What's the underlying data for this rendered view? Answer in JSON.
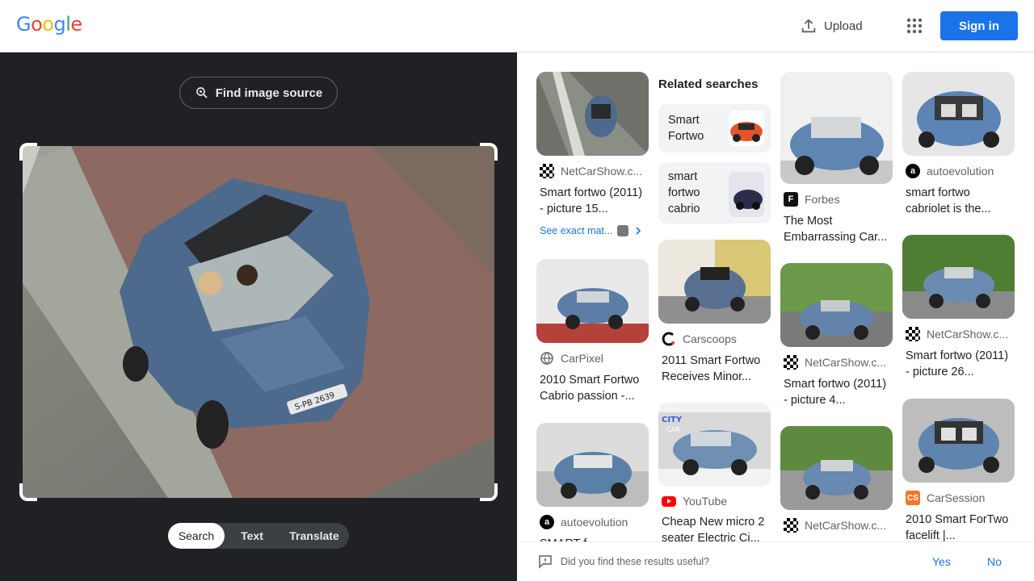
{
  "header": {
    "logo_letters": [
      "G",
      "o",
      "o",
      "g",
      "l",
      "e"
    ],
    "upload_label": "Upload",
    "signin_label": "Sign in",
    "colors": {
      "blue": "#4285f4",
      "red": "#ea4335",
      "yellow": "#fbbc05",
      "green": "#34a853",
      "accent": "#1a73e8"
    }
  },
  "lens": {
    "find_source_label": "Find image source",
    "modes": [
      "Search",
      "Text",
      "Translate"
    ],
    "active_mode": "Search",
    "plate_text": "S-PB 2639"
  },
  "results": {
    "related_heading": "Related searches",
    "related": [
      {
        "label": "Smart\nFortwo",
        "lines": [
          "Smart",
          "Fortwo"
        ]
      },
      {
        "label": "smart fortwo cabrio",
        "lines": [
          "smart",
          "fortwo",
          "cabrio"
        ]
      }
    ],
    "see_exact": "See exact mat...",
    "col1": [
      {
        "source": "NetCarShow.c...",
        "title": "Smart fortwo (2011) - picture 15...",
        "icon": "checker-icon"
      },
      {
        "source": "CarPixel",
        "title": "2010 Smart Fortwo Cabrio passion -...",
        "icon": "globe-icon"
      },
      {
        "source": "autoevolution",
        "title": "SMART f...",
        "icon": "a-icon"
      }
    ],
    "col2": [
      {
        "source": "Carscoops",
        "title": "2011 Smart Fortwo Receives Minor...",
        "icon": "c-icon"
      },
      {
        "source": "YouTube",
        "title": "Cheap New micro 2 seater Electric Ci...",
        "icon": "youtube-icon",
        "thumb_text": "CITY CAR"
      }
    ],
    "col3": [
      {
        "source": "Forbes",
        "title": "The Most Embarrassing Car...",
        "icon": "f-icon"
      },
      {
        "source": "NetCarShow.c...",
        "title": "Smart fortwo (2011) - picture 4...",
        "icon": "checker-icon"
      },
      {
        "source": "NetCarShow.c...",
        "title": "",
        "icon": "checker-icon"
      }
    ],
    "col4": [
      {
        "source": "autoevolution",
        "title": "smart fortwo cabriolet is the...",
        "icon": "a-icon"
      },
      {
        "source": "NetCarShow.c...",
        "title": "Smart fortwo (2011) - picture 26...",
        "icon": "checker-icon"
      },
      {
        "source": "CarSession",
        "title": "2010 Smart ForTwo facelift |...",
        "icon": "cs-icon"
      }
    ]
  },
  "feedback": {
    "question": "Did you find these results useful?",
    "yes": "Yes",
    "no": "No"
  }
}
